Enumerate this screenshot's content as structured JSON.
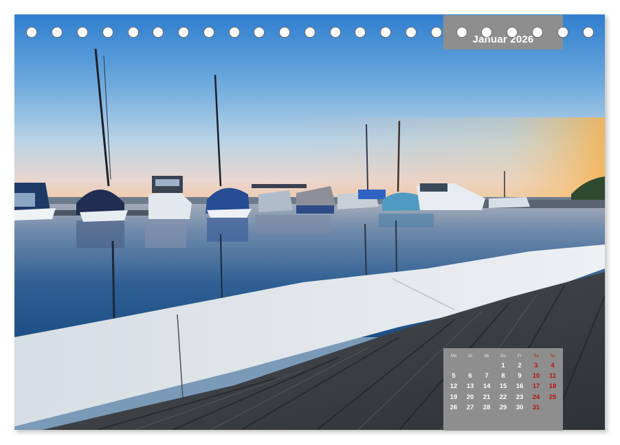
{
  "calendar": {
    "month_title": "Januar 2026",
    "weekday_headers": [
      "Mo",
      "Di",
      "Mi",
      "Do",
      "Fr",
      "Sa",
      "So"
    ],
    "weeks": [
      [
        "",
        "",
        "",
        "1",
        "2",
        "3",
        "4"
      ],
      [
        "5",
        "6",
        "7",
        "8",
        "9",
        "10",
        "11"
      ],
      [
        "12",
        "13",
        "14",
        "15",
        "16",
        "17",
        "18"
      ],
      [
        "19",
        "20",
        "21",
        "22",
        "23",
        "24",
        "25"
      ],
      [
        "26",
        "27",
        "28",
        "29",
        "30",
        "31",
        ""
      ]
    ]
  },
  "photo": {
    "subject": "Marina at sunset with sailboats and motorboats reflected in calm water, wooden jetty with concrete edge in foreground"
  },
  "colors": {
    "label_background": "#8e8e8e",
    "label_text": "#ffffff",
    "holiday_red": "#b81414",
    "binding_ring_border": "#6b6b6b"
  }
}
